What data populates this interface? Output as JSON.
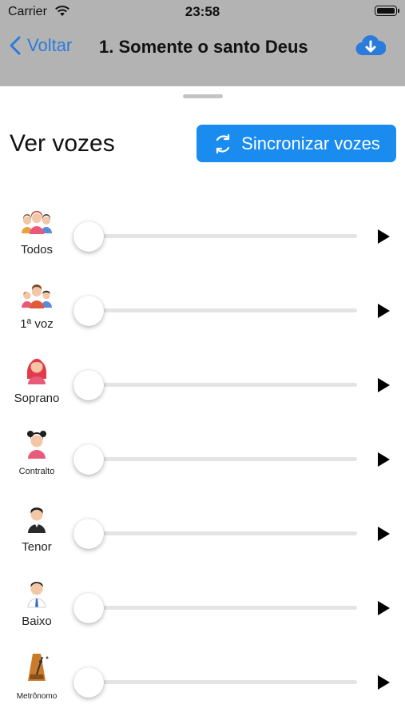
{
  "status_bar": {
    "carrier": "Carrier",
    "time": "23:58"
  },
  "nav": {
    "back_label": "Voltar",
    "title": "1. Somente o santo Deus"
  },
  "panel": {
    "heading": "Ver vozes",
    "sync_label": "Sincronizar vozes"
  },
  "voices": [
    {
      "label": "Todos",
      "icon": "group-icon",
      "level": 0
    },
    {
      "label": "1ª voz",
      "icon": "family-icon",
      "level": 0
    },
    {
      "label": "Soprano",
      "icon": "soprano-woman-icon",
      "level": 0
    },
    {
      "label": "Contralto",
      "icon": "contralto-woman-icon",
      "level": 0
    },
    {
      "label": "Tenor",
      "icon": "tenor-man-icon",
      "level": 0
    },
    {
      "label": "Baixo",
      "icon": "bass-man-icon",
      "level": 0
    },
    {
      "label": "Metrônomo",
      "icon": "metronome-icon",
      "level": 0
    }
  ],
  "colors": {
    "accent": "#1a8cf0",
    "link": "#2b7bdc",
    "dim_overlay": "#b3b3b3"
  }
}
